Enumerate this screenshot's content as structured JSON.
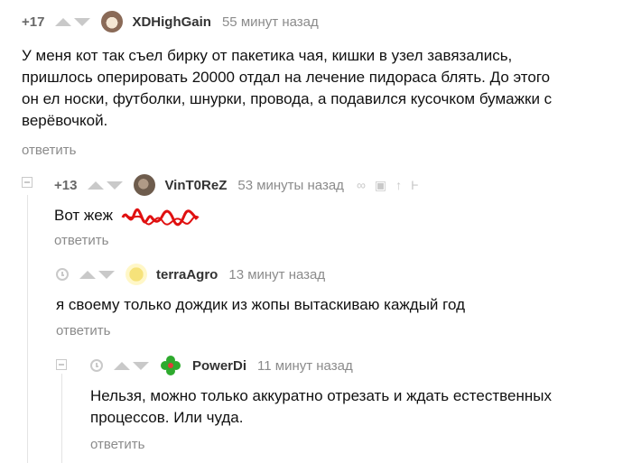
{
  "comments": [
    {
      "rating": "+17",
      "username": "XDHighGain",
      "time": "55 минут назад",
      "text": "У меня кот так съел бирку от пакетика чая, кишки в узел завязались, пришлось оперировать 20000 отдал на лечение пидораса блять. До этого он ел носки, футболки, шнурки, провода, а подавился кусочком бумажки с верёвочкой.",
      "reply": "ответить",
      "avatar_icon": "raccoon-avatar"
    },
    {
      "rating": "+13",
      "username": "VinT0ReZ",
      "time": "53 минуты назад",
      "text_visible": "Вот жеж",
      "scribble_note": "red-scribble-censor",
      "reply": "ответить",
      "avatar_icon": "cat-photo-avatar"
    },
    {
      "username": "terraAgro",
      "time": "13 минут назад",
      "text": "я своему только дождик из жопы вытаскиваю каждый год",
      "reply": "ответить",
      "avatar_icon": "cheese-avatar"
    },
    {
      "username": "PowerDi",
      "time": "11 минут назад",
      "text": "Нельзя, можно только аккуратно отрезать и ждать естественных процессов. Или чуда.",
      "reply": "ответить",
      "avatar_icon": "clover-avatar"
    }
  ],
  "colors": {
    "muted": "#8b8b8b",
    "arrow": "#c9c9c9",
    "scribble": "#e01010",
    "clover": "#2eaa2e"
  }
}
